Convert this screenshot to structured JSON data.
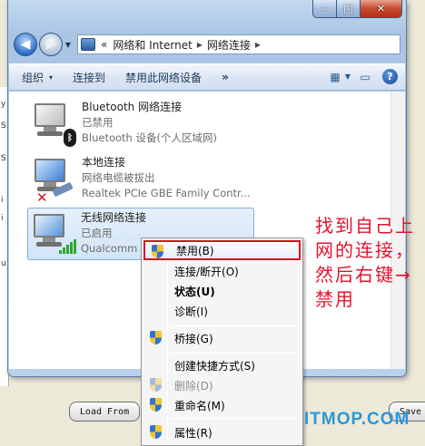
{
  "window": {
    "caption": {
      "minimize": "‒",
      "maximize": "□",
      "close": "✕"
    }
  },
  "address": {
    "prefix": "«",
    "crumbs": [
      "网络和 Internet",
      "网络连接"
    ],
    "sep": "▸"
  },
  "toolbar": {
    "items": [
      "组织",
      "连接到",
      "禁用此网络设备"
    ],
    "organize_arrow": "▾",
    "more": "»"
  },
  "connections": [
    {
      "name": "Bluetooth 网络连接",
      "status": "已禁用",
      "device": "Bluetooth 设备(个人区域网)"
    },
    {
      "name": "本地连接",
      "status": "网络电缆被拔出",
      "device": "Realtek PCIe GBE Family Contr..."
    },
    {
      "name": "无线网络连接",
      "status": "已启用",
      "device": "Qualcomm A"
    }
  ],
  "context_menu": {
    "items": [
      {
        "label": "禁用(B)"
      },
      {
        "label": "连接/断开(O)"
      },
      {
        "label": "状态(U)"
      },
      {
        "label": "诊断(I)"
      },
      {
        "label": "桥接(G)"
      },
      {
        "label": "创建快捷方式(S)"
      },
      {
        "label": "删除(D)"
      },
      {
        "label": "重命名(M)"
      },
      {
        "label": "属性(R)"
      }
    ]
  },
  "background": {
    "load_button": "Load From",
    "save_button": "Save T",
    "strip_chars": [
      "y",
      "S",
      "S",
      "i",
      "i",
      "u"
    ]
  },
  "annotation": "找到自己上网的连接，然后右键→禁用",
  "watermark": "ITMOP.COM",
  "colors": {
    "highlight_border": "#d3161b",
    "annotation": "#e3122c",
    "watermark": "#2b97d6"
  }
}
